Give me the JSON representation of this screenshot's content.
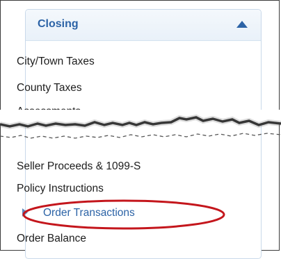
{
  "panel": {
    "title": "Closing",
    "items": [
      {
        "label": "City/Town Taxes"
      },
      {
        "label": "County Taxes"
      },
      {
        "label": "Assessments"
      },
      {
        "label": "Seller Proceeds & 1099-S"
      },
      {
        "label": "Policy Instructions"
      },
      {
        "label": "Order Transactions",
        "active": true
      },
      {
        "label": "Order Balance"
      }
    ]
  },
  "colors": {
    "accent": "#2c63a6",
    "highlight_circle": "#c4161c",
    "panel_border": "#c9d9ea"
  },
  "icons": {
    "collapse": "triangle-up-icon",
    "active_marker": "triangle-right-icon"
  }
}
